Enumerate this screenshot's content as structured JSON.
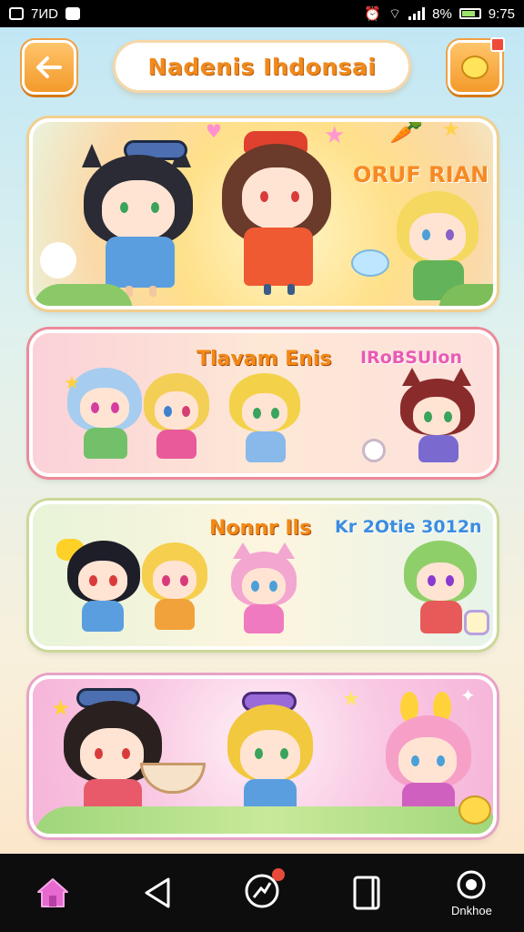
{
  "status_bar": {
    "left_text": "7ИD",
    "battery_text": "8%",
    "time": "9:75"
  },
  "header": {
    "title": "Nadenis Ihdonsai",
    "back_icon": "back-arrow-icon",
    "chat_icon": "chat-bubble-icon",
    "notification_badge": ""
  },
  "cards": [
    {
      "label": "ORUF RIAN",
      "theme": "banner-yellow"
    },
    {
      "label": "Tlavam Enis",
      "secondary_label": "IRoBSUIon",
      "theme": "pink"
    },
    {
      "label": "Nonnr Ils",
      "secondary_label": "Kr 2Otie 3012n",
      "theme": "green"
    },
    {
      "label": "",
      "theme": "pink-sparkle"
    }
  ],
  "nav": {
    "items": [
      {
        "icon": "home-icon",
        "label": ""
      },
      {
        "icon": "back-triangle-icon",
        "label": ""
      },
      {
        "icon": "compass-icon",
        "label": ""
      },
      {
        "icon": "recent-apps-icon",
        "label": ""
      },
      {
        "icon": "target-icon",
        "label": "Dnkhoe"
      }
    ]
  },
  "colors": {
    "accent_orange": "#f39a2a",
    "title_orange": "#f08a1c",
    "nav_bg": "#0d0d0d",
    "home_icon": "#e76ad1"
  }
}
